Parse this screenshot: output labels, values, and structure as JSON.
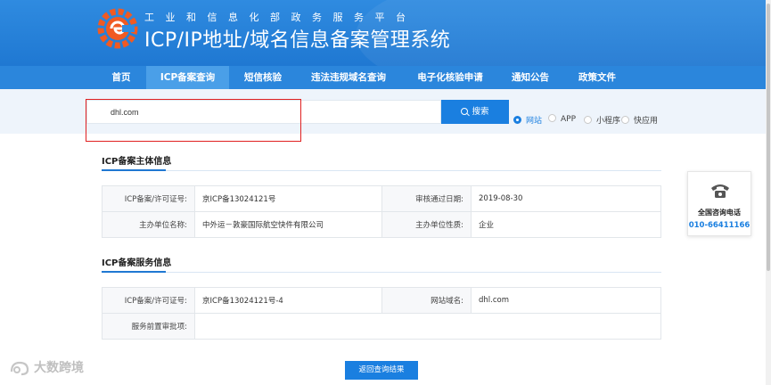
{
  "header": {
    "org_line": "工业和信息化部政务服务平台",
    "title": "ICP/IP地址/域名信息备案管理系统"
  },
  "nav": {
    "items": [
      {
        "label": "首页"
      },
      {
        "label": "ICP备案查询"
      },
      {
        "label": "短信核验"
      },
      {
        "label": "违法违规域名查询"
      },
      {
        "label": "电子化核验申请"
      },
      {
        "label": "通知公告"
      },
      {
        "label": "政策文件"
      }
    ],
    "active_index": 1
  },
  "search": {
    "value": "dhl.com",
    "button_label": "搜索",
    "radio_options": [
      {
        "label": "网站",
        "checked": true
      },
      {
        "label": "APP",
        "checked": false
      },
      {
        "label": "小程序",
        "checked": false
      },
      {
        "label": "快应用",
        "checked": false
      }
    ]
  },
  "subject_section": {
    "title": "ICP备案主体信息",
    "rows": [
      {
        "label1": "ICP备案/许可证号:",
        "value1": "京ICP备13024121号",
        "label2": "审核通过日期:",
        "value2": "2019-08-30"
      },
      {
        "label1": "主办单位名称:",
        "value1": "中外运－敦豪国际航空快件有限公司",
        "label2": "主办单位性质:",
        "value2": "企业"
      }
    ]
  },
  "service_section": {
    "title": "ICP备案服务信息",
    "rows": [
      {
        "label1": "ICP备案/许可证号:",
        "value1": "京ICP备13024121号-4",
        "label2": "网站域名:",
        "value2": "dhl.com"
      },
      {
        "label1": "服务前置审批项:",
        "value1": "",
        "label2": "",
        "value2": ""
      }
    ]
  },
  "side_panel": {
    "icon": "phone-icon",
    "label": "全国咨询电话",
    "number": "010-66411166"
  },
  "back_button_label": "返回查询结果",
  "watermark": "大数跨境",
  "colors": {
    "primary": "#1f78d2",
    "button": "#1a7fe0",
    "highlight_border": "#e02020"
  }
}
